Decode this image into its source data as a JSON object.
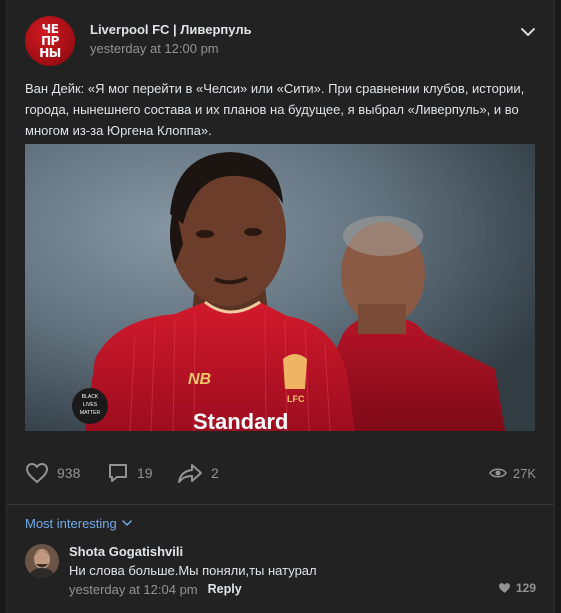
{
  "post": {
    "group_name": "Liverpool FC | Ливерпуль",
    "avatar_text": [
      "ЧЕ",
      "ПР",
      "НЫ"
    ],
    "time": "yesterday at 12:00 pm",
    "text": "Ван Дейк: «Я мог перейти в «Челси» или «Сити». При сравнении клубов, истории, города, нынешнего состава и их планов на будущее, я выбрал «Ливерпуль», и во многом из-за Юргена Клоппа».",
    "photo": {
      "shirt_sponsor": "Standard",
      "crest_text": "LFC",
      "badge_text": [
        "BLACK",
        "LIVES",
        "MATTER"
      ]
    }
  },
  "actions": {
    "likes": "938",
    "comments": "19",
    "shares": "2",
    "views": "27K"
  },
  "comments_section": {
    "sort_label": "Most interesting",
    "comments": [
      {
        "author": "Shota Gogatishvili",
        "text": "Ни слова больше.Мы поняли,ты натурал",
        "time": "yesterday at 12:04 pm",
        "reply_label": "Reply",
        "likes": "129"
      }
    ]
  },
  "colors": {
    "background": "#191919",
    "card": "#222222",
    "link": "#71aaeb",
    "muted": "#939393",
    "text": "#e1e3e6",
    "shirt_red": "#c8102e"
  }
}
